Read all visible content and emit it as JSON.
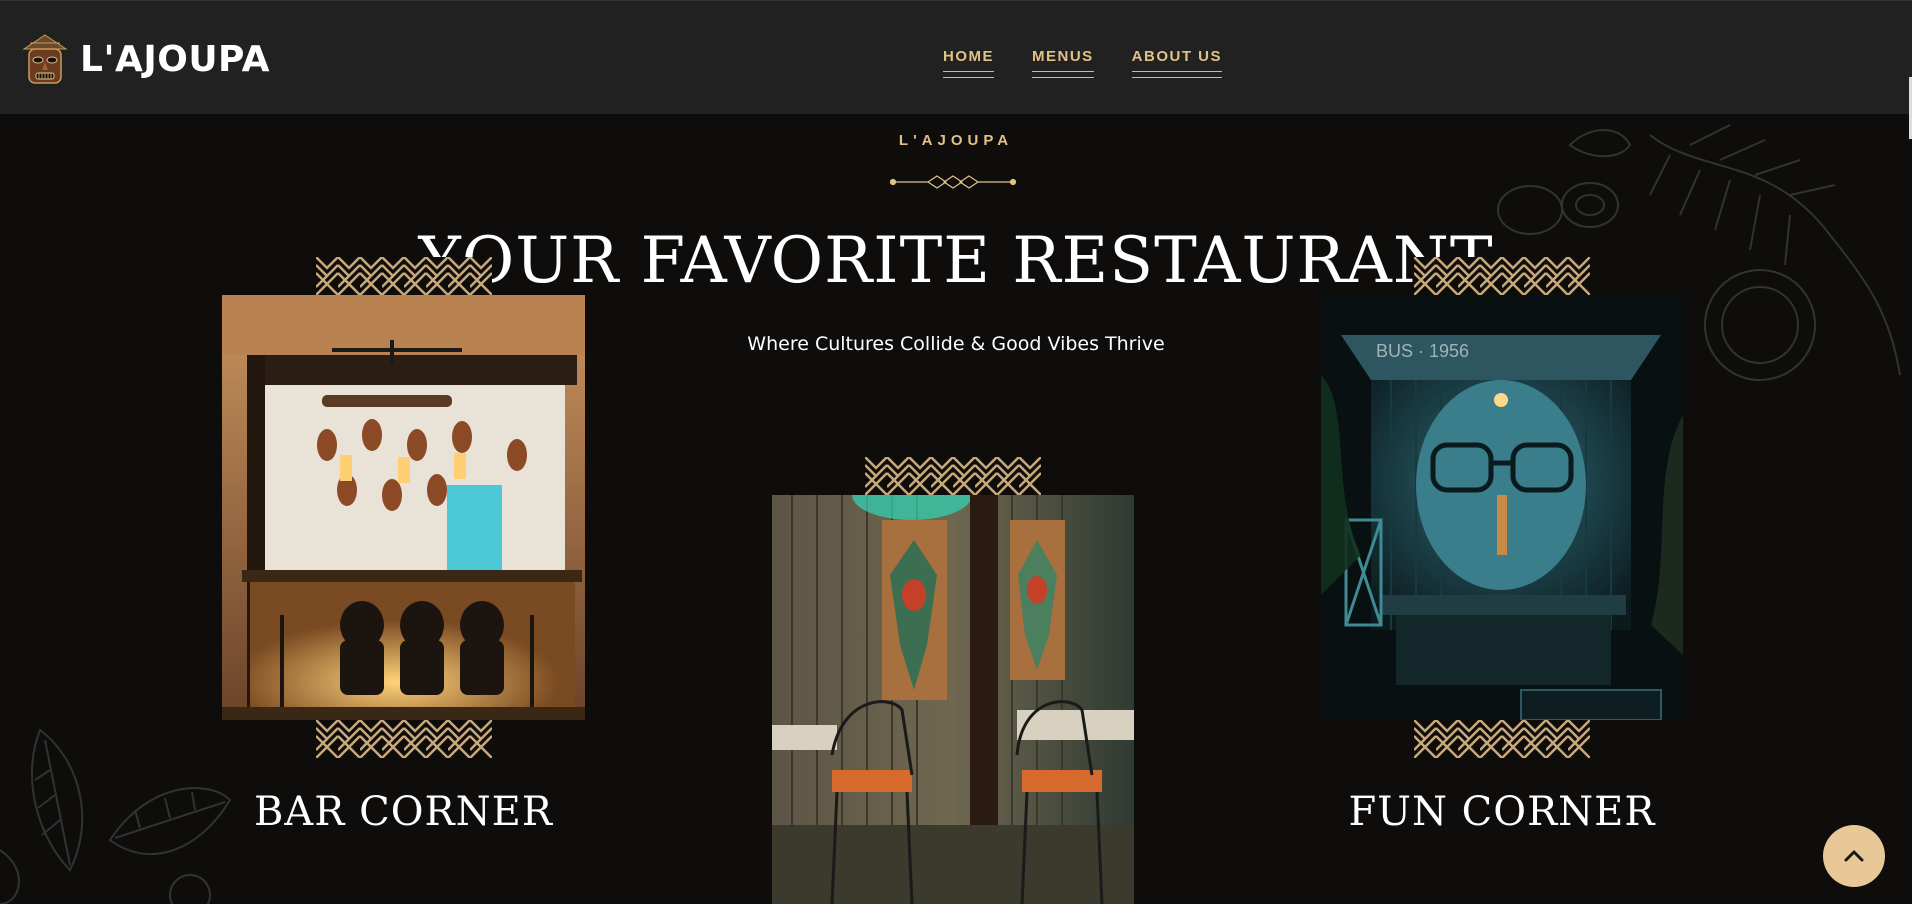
{
  "header": {
    "brand": "L'AJOUPA",
    "nav": [
      {
        "label": "HOME"
      },
      {
        "label": "MENUS"
      },
      {
        "label": "ABOUT US"
      }
    ]
  },
  "hero": {
    "eyebrow": "L'AJOUPA",
    "title": "YOUR FAVORITE RESTAURANT",
    "subtitle": "Where Cultures Collide & Good Vibes Thrive"
  },
  "cards": [
    {
      "title": "BAR CORNER",
      "image": "bar-interior-photo"
    },
    {
      "title": "",
      "image": "dining-corner-photo"
    },
    {
      "title": "FUN CORNER",
      "image": "mural-booth-photo"
    }
  ],
  "colors": {
    "accent": "#e2c186",
    "background": "#0e0d0c",
    "header": "#222121"
  },
  "icons": {
    "logo": "tiki-mask-icon",
    "scroll_top": "chevron-up-icon"
  }
}
